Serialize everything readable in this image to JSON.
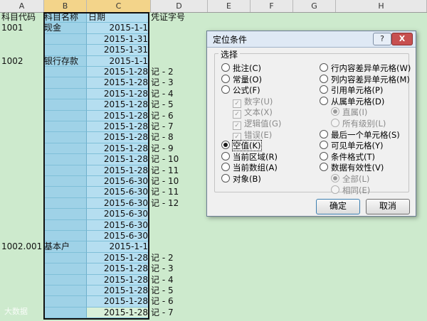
{
  "columns": [
    "A",
    "B",
    "C",
    "D",
    "E",
    "F",
    "G",
    "H"
  ],
  "rows": [
    {
      "a": "科目代码",
      "b": "科目名称",
      "c": "日期",
      "d": "凭证字号"
    },
    {
      "a": "1001",
      "b": "现金",
      "c": "2015-1-1",
      "d": ""
    },
    {
      "a": "",
      "b": "",
      "c": "2015-1-31",
      "d": ""
    },
    {
      "a": "",
      "b": "",
      "c": "2015-1-31",
      "d": ""
    },
    {
      "a": "1002",
      "b": "银行存款",
      "c": "2015-1-1",
      "d": ""
    },
    {
      "a": "",
      "b": "",
      "c": "2015-1-28",
      "d": "记 - 2"
    },
    {
      "a": "",
      "b": "",
      "c": "2015-1-28",
      "d": "记 - 3"
    },
    {
      "a": "",
      "b": "",
      "c": "2015-1-28",
      "d": "记 - 4"
    },
    {
      "a": "",
      "b": "",
      "c": "2015-1-28",
      "d": "记 - 5"
    },
    {
      "a": "",
      "b": "",
      "c": "2015-1-28",
      "d": "记 - 6"
    },
    {
      "a": "",
      "b": "",
      "c": "2015-1-28",
      "d": "记 - 7"
    },
    {
      "a": "",
      "b": "",
      "c": "2015-1-28",
      "d": "记 - 8"
    },
    {
      "a": "",
      "b": "",
      "c": "2015-1-28",
      "d": "记 - 9"
    },
    {
      "a": "",
      "b": "",
      "c": "2015-1-28",
      "d": "记 - 10"
    },
    {
      "a": "",
      "b": "",
      "c": "2015-1-28",
      "d": "记 - 11"
    },
    {
      "a": "",
      "b": "",
      "c": "2015-6-30",
      "d": "记 - 10"
    },
    {
      "a": "",
      "b": "",
      "c": "2015-6-30",
      "d": "记 - 11"
    },
    {
      "a": "",
      "b": "",
      "c": "2015-6-30",
      "d": "记 - 12"
    },
    {
      "a": "",
      "b": "",
      "c": "2015-6-30",
      "d": ""
    },
    {
      "a": "",
      "b": "",
      "c": "2015-6-30",
      "d": ""
    },
    {
      "a": "",
      "b": "",
      "c": "2015-6-30",
      "d": ""
    },
    {
      "a": "1002.001",
      "b": "基本户",
      "c": "2015-1-1",
      "d": ""
    },
    {
      "a": "",
      "b": "",
      "c": "2015-1-28",
      "d": "记 - 2"
    },
    {
      "a": "",
      "b": "",
      "c": "2015-1-28",
      "d": "记 - 3"
    },
    {
      "a": "",
      "b": "",
      "c": "2015-1-28",
      "d": "记 - 4"
    },
    {
      "a": "",
      "b": "",
      "c": "2015-1-28",
      "d": "记 - 5"
    },
    {
      "a": "",
      "b": "",
      "c": "2015-1-28",
      "d": "记 - 6"
    },
    {
      "a": "",
      "b": "",
      "c": "2015-1-28",
      "d": "记 - 7"
    }
  ],
  "dialog": {
    "title": "定位条件",
    "help": "?",
    "close": "X",
    "group_label": "选择",
    "left_options": [
      {
        "label": "批注(C)",
        "type": "radio",
        "checked": false,
        "disabled": false
      },
      {
        "label": "常量(O)",
        "type": "radio",
        "checked": false,
        "disabled": false
      },
      {
        "label": "公式(F)",
        "type": "radio",
        "checked": false,
        "disabled": false
      },
      {
        "label": "数字(U)",
        "type": "check",
        "checked": true,
        "disabled": true
      },
      {
        "label": "文本(X)",
        "type": "check",
        "checked": true,
        "disabled": true
      },
      {
        "label": "逻辑值(G)",
        "type": "check",
        "checked": true,
        "disabled": true
      },
      {
        "label": "错误(E)",
        "type": "check",
        "checked": true,
        "disabled": true
      },
      {
        "label": "空值(K)",
        "type": "radio",
        "checked": true,
        "disabled": false
      },
      {
        "label": "当前区域(R)",
        "type": "radio",
        "checked": false,
        "disabled": false
      },
      {
        "label": "当前数组(A)",
        "type": "radio",
        "checked": false,
        "disabled": false
      },
      {
        "label": "对象(B)",
        "type": "radio",
        "checked": false,
        "disabled": false
      }
    ],
    "right_options": [
      {
        "label": "行内容差异单元格(W)",
        "type": "radio",
        "checked": false,
        "disabled": false
      },
      {
        "label": "列内容差异单元格(M)",
        "type": "radio",
        "checked": false,
        "disabled": false
      },
      {
        "label": "引用单元格(P)",
        "type": "radio",
        "checked": false,
        "disabled": false
      },
      {
        "label": "从属单元格(D)",
        "type": "radio",
        "checked": false,
        "disabled": false
      },
      {
        "label": "直属(I)",
        "type": "radio",
        "checked": true,
        "disabled": true
      },
      {
        "label": "所有级别(L)",
        "type": "radio",
        "checked": false,
        "disabled": true
      },
      {
        "label": "最后一个单元格(S)",
        "type": "radio",
        "checked": false,
        "disabled": false
      },
      {
        "label": "可见单元格(Y)",
        "type": "radio",
        "checked": false,
        "disabled": false
      },
      {
        "label": "条件格式(T)",
        "type": "radio",
        "checked": false,
        "disabled": false
      },
      {
        "label": "数据有效性(V)",
        "type": "radio",
        "checked": false,
        "disabled": false
      },
      {
        "label": "全部(L)",
        "type": "radio",
        "checked": true,
        "disabled": true
      },
      {
        "label": "相同(E)",
        "type": "radio",
        "checked": false,
        "disabled": true
      }
    ],
    "ok_label": "确定",
    "cancel_label": "取消"
  },
  "watermark": "大数据"
}
